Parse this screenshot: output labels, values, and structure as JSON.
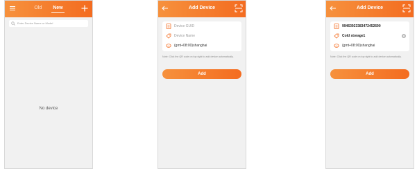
{
  "screens": {
    "list": {
      "tabs": [
        "Old",
        "New"
      ],
      "active_tab": "New",
      "search_placeholder": "Enter Device Name or Model",
      "empty_text": "No device"
    },
    "add_empty": {
      "title": "Add Device",
      "guid_placeholder": "Device GUID",
      "name_placeholder": "Device Name",
      "timezone": "(gmt+08:00)shanghai",
      "note": "Note: Click the QR code on top right to add device automatically.",
      "add_label": "Add"
    },
    "add_filled": {
      "title": "Add Device",
      "guid_value": "99463923383472452690",
      "name_value": "Cold storage1",
      "timezone": "(gmt+08:00)shanghai",
      "note": "Note: Click the QR code on top right to add device automatically.",
      "add_label": "Add"
    }
  },
  "colors": {
    "accent": "#f46c20",
    "accent_light": "#f6913d",
    "background": "#f1f1f1"
  },
  "icons": [
    "menu-icon",
    "plus-icon",
    "back-arrow-icon",
    "qr-scan-icon",
    "device-guid-icon",
    "tag-icon",
    "timezone-icon",
    "clear-icon",
    "search-icon"
  ]
}
